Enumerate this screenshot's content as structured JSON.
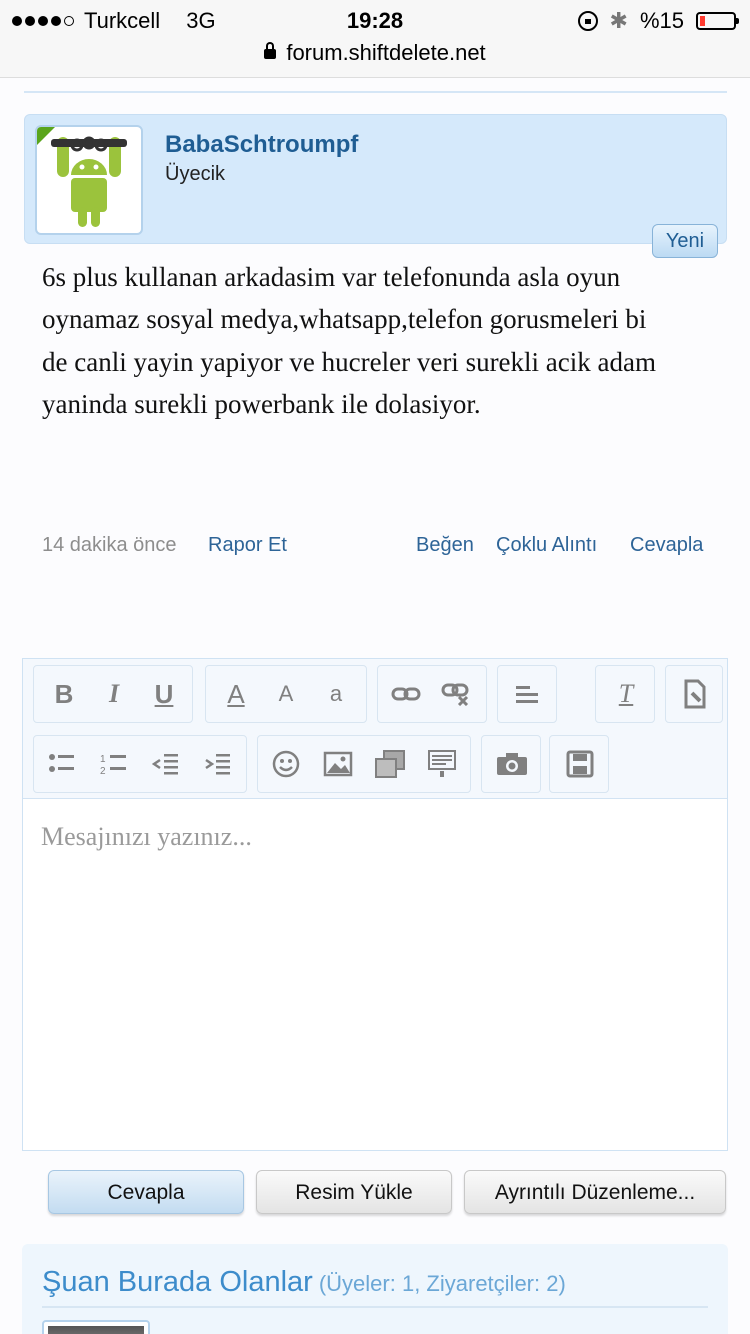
{
  "status_bar": {
    "carrier": "Turkcell",
    "network": "3G",
    "time": "19:28",
    "battery": "%15",
    "battery_level": 0.15
  },
  "browser": {
    "url": "forum.shiftdelete.net"
  },
  "post": {
    "username": "BabaSchtroumpf",
    "user_title": "Üyecik",
    "badge": "Yeni",
    "message": "6s plus kullanan arkadasim var telefonunda asla oyun oynamaz sosyal medya,whatsapp,telefon gorusmeleri bi de canli yayin yapiyor ve hucreler veri surekli acik adam yaninda surekli powerbank ile dolasiyor.",
    "time": "14 dakika önce",
    "report": "Rapor Et",
    "like": "Beğen",
    "multi_quote": "Çoklu Alıntı",
    "reply": "Cevapla"
  },
  "editor": {
    "placeholder": "Mesajınızı yazınız...",
    "toolbar": {
      "bold": "B",
      "italic": "I",
      "underline": "U",
      "font_color": "A",
      "font_size": "A",
      "font_family": "a",
      "clear_format": "T"
    }
  },
  "buttons": {
    "reply": "Cevapla",
    "upload_image": "Resim Yükle",
    "advanced_edit": "Ayrıntılı Düzenleme..."
  },
  "online": {
    "title": "Şuan Burada Olanlar",
    "counts": "(Üyeler: 1, Ziyaretçiler: 2)"
  },
  "colors": {
    "link": "#2e6497",
    "header_bg": "#d5e9fb",
    "username": "#1f5d93",
    "android_green": "#9bc33c"
  }
}
